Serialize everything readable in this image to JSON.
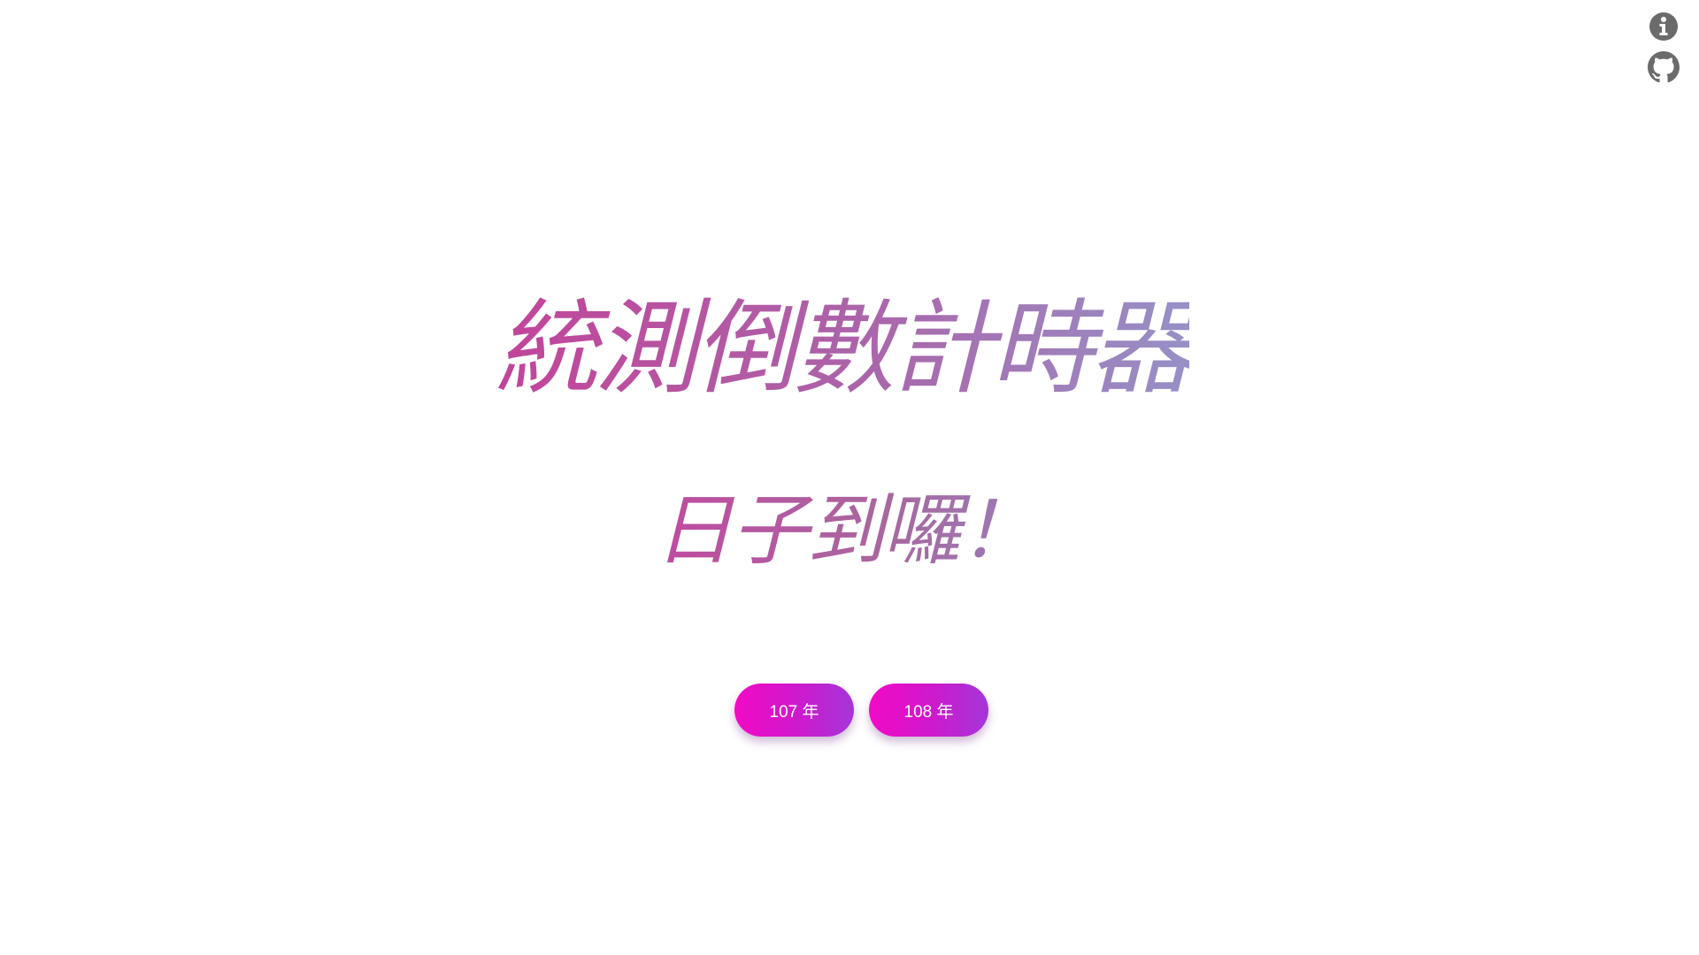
{
  "title": "統測倒數計時器",
  "subtitle": "日子到囉！",
  "buttons": [
    {
      "label": "107 年"
    },
    {
      "label": "108 年"
    }
  ],
  "icons": {
    "info": "info-icon",
    "github": "github-icon"
  },
  "colors": {
    "title_gradient_start": "#c2449a",
    "title_gradient_end": "#9790c6",
    "button_gradient_start": "#f20ac6",
    "button_gradient_end": "#a436d8",
    "icon_color": "#6b6b6b"
  }
}
